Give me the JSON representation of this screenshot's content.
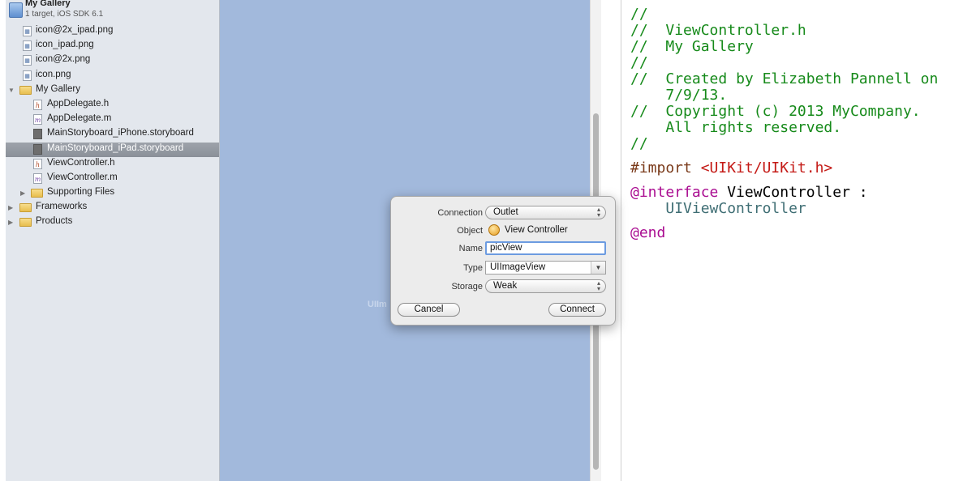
{
  "navigator": {
    "project": {
      "name": "My Gallery",
      "subtitle": "1 target, iOS SDK 6.1"
    },
    "items": [
      {
        "label": "icon@2x_ipad.png",
        "kind": "image"
      },
      {
        "label": "icon_ipad.png",
        "kind": "image"
      },
      {
        "label": "icon@2x.png",
        "kind": "image"
      },
      {
        "label": "icon.png",
        "kind": "image"
      },
      {
        "label": "My Gallery",
        "kind": "folder-open"
      },
      {
        "label": "AppDelegate.h",
        "kind": "header"
      },
      {
        "label": "AppDelegate.m",
        "kind": "implementation"
      },
      {
        "label": "MainStoryboard_iPhone.storyboard",
        "kind": "storyboard"
      },
      {
        "label": "MainStoryboard_iPad.storyboard",
        "kind": "storyboard",
        "selected": true
      },
      {
        "label": "ViewController.h",
        "kind": "header"
      },
      {
        "label": "ViewController.m",
        "kind": "implementation"
      },
      {
        "label": "Supporting Files",
        "kind": "folder"
      },
      {
        "label": "Frameworks",
        "kind": "folder"
      },
      {
        "label": "Products",
        "kind": "folder"
      }
    ]
  },
  "canvas": {
    "ghost_text": "UIIm"
  },
  "popover": {
    "connection_label": "Connection",
    "connection_value": "Outlet",
    "object_label": "Object",
    "object_value": "View Controller",
    "name_label": "Name",
    "name_value": "picView",
    "type_label": "Type",
    "type_value": "UIImageView",
    "storage_label": "Storage",
    "storage_value": "Weak",
    "cancel_label": "Cancel",
    "connect_label": "Connect"
  },
  "editor": {
    "comment_slashes": "//",
    "filename": "ViewController.h",
    "project": "My Gallery",
    "created_line1": "Created by Elizabeth Pannell on",
    "created_line2": "7/9/13.",
    "copyright_line1": "Copyright (c) 2013 MyCompany.",
    "copyright_line2": "All rights reserved.",
    "import_directive": "#import",
    "import_path": "<UIKit/UIKit.h>",
    "interface_keyword": "@interface",
    "class_decl": "ViewController :",
    "superclass": "UIViewController",
    "end_keyword": "@end"
  },
  "colors": {
    "canvas": "#a2b9dc",
    "comment": "#168a1a",
    "keyword": "#aa0d91",
    "string": "#c41a16"
  }
}
